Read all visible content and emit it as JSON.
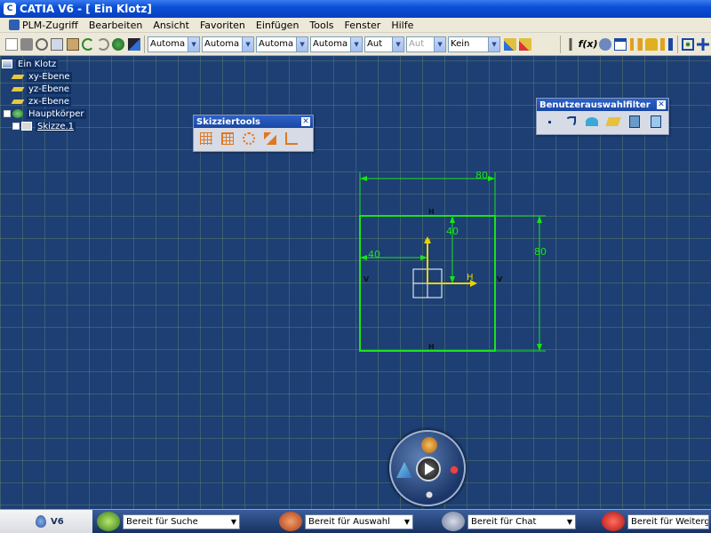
{
  "window": {
    "title": "CATIA V6 - [ Ein Klotz]"
  },
  "menu": [
    "PLM-Zugriff",
    "Bearbeiten",
    "Ansicht",
    "Favoriten",
    "Einfügen",
    "Tools",
    "Fenster",
    "Hilfe"
  ],
  "toolbar": {
    "combos": [
      {
        "value": "Automa",
        "width": 46
      },
      {
        "value": "Automa",
        "width": 46
      },
      {
        "value": "Automa",
        "width": 46
      },
      {
        "value": "Automa",
        "width": 46
      },
      {
        "value": "Aut",
        "width": 32
      },
      {
        "value": "Aut",
        "width": 32,
        "disabled": true
      },
      {
        "value": "Kein",
        "width": 46
      }
    ]
  },
  "tree": {
    "root": "Ein Klotz",
    "items": [
      "xy-Ebene",
      "yz-Ebene",
      "zx-Ebene",
      "Hauptkörper",
      "Skizze.1"
    ]
  },
  "palettes": {
    "sketch_tools": {
      "title": "Skizziertools"
    },
    "selection_filter": {
      "title": "Benutzerauswahlfilter"
    }
  },
  "sketch": {
    "dimensions": {
      "width": "80",
      "height": "80",
      "offset_x": "40",
      "offset_y": "40"
    },
    "axis_labels": {
      "h": "H",
      "v": "V"
    },
    "constraint_labels": {
      "top": "H",
      "bottom": "H",
      "left": "V",
      "right": "V"
    }
  },
  "statusbar": {
    "brand": "V6",
    "fields": [
      {
        "value": "Bereit für Suche"
      },
      {
        "value": "Bereit für Auswahl"
      },
      {
        "value": "Bereit für Chat"
      },
      {
        "value": "Bereit für Weitergabe"
      }
    ]
  },
  "colors": {
    "sketch_green": "#18e418",
    "axis_yellow": "#e8d400",
    "canvas_bg": "#1d3f73"
  }
}
